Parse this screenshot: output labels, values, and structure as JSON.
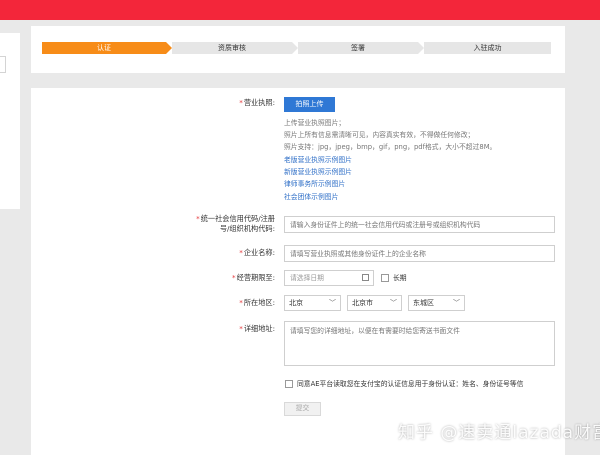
{
  "colors": {
    "brand": "#f3263a",
    "step_active": "#f78c18",
    "primary": "#2f78d5",
    "link": "#2f6fc7"
  },
  "steps": [
    {
      "label": "认证"
    },
    {
      "label": "资质审核"
    },
    {
      "label": "签署"
    },
    {
      "label": "入驻成功"
    }
  ],
  "form": {
    "license_label": "营业执照:",
    "upload_button": "拍照上传",
    "hints": [
      "上传营业执照图片；",
      "照片上所有信息需清晰可见，内容真实有效，不得做任何修改；",
      "照片支持：jpg，jpeg，bmp，gif，png，pdf格式，大小不超过8M。"
    ],
    "links": [
      "老版营业执照示例图片",
      "新版营业执照示例图片",
      "律师事务所示例图片",
      "社会团体示例图片"
    ],
    "credit_code_label_1": "统一社会信用代码/注册",
    "credit_code_label_2": "号/组织机构代码:",
    "credit_code_placeholder": "请输入身份证件上的统一社会信用代码或注册号或组织机构代码",
    "company_label": "企业名称:",
    "company_placeholder": "请填写营业执照或其他身份证件上的企业名称",
    "period_label": "经营期限至:",
    "period_placeholder": "请选择日期",
    "long_term_label": "长期",
    "region_label": "所在地区:",
    "province": "北京",
    "city": "北京市",
    "district": "东城区",
    "address_label": "详细地址:",
    "address_placeholder": "请填写您的详细地址，以便在有需要时给您寄送书面文件",
    "agree_text": "同意AE平台读取您在支付宝的认证信息用于身份认证：姓名、身份证号等信",
    "submit_label": "提交"
  },
  "watermark": "知乎 @速卖通lazada财富"
}
